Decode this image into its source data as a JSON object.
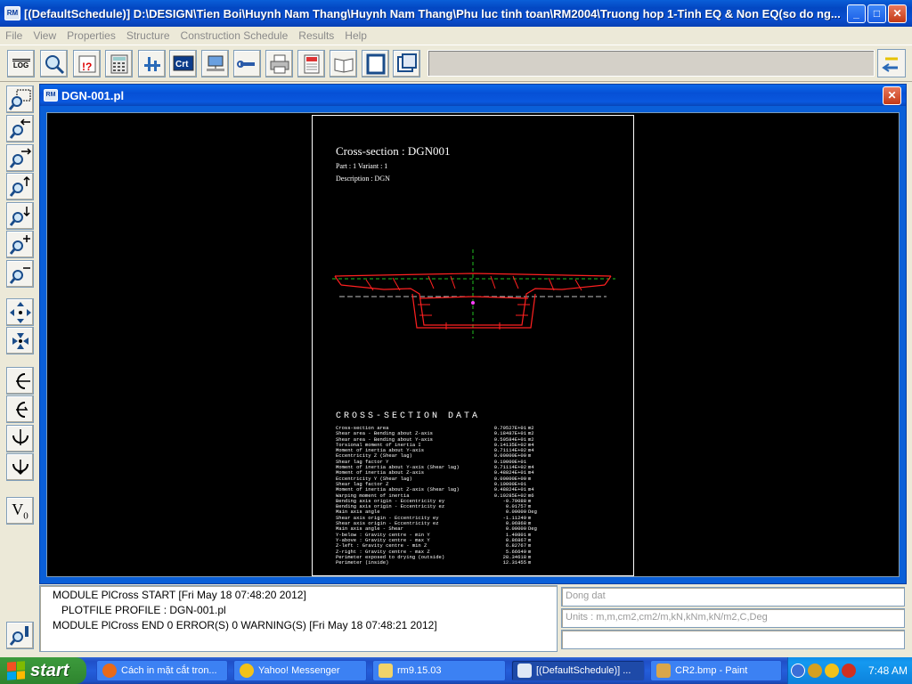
{
  "window": {
    "title": "[(DefaultSchedule)] D:\\DESIGN\\Tien Boi\\Huynh Nam Thang\\Huynh Nam Thang\\Phu luc tinh toan\\RM2004\\Truong hop 1-Tinh EQ & Non EQ(so do ng...",
    "logo": "RM",
    "minimize": "_",
    "maximize": "□",
    "close": "✕"
  },
  "menu": [
    "File",
    "View",
    "Properties",
    "Structure",
    "Construction Schedule",
    "Results",
    "Help"
  ],
  "toolbar": {
    "log_label": "LOG",
    "buttons": [
      "log-icon",
      "zoom-icon",
      "help-query-icon",
      "calculator-icon",
      "structure-icon",
      "crt-icon",
      "network-icon",
      "wrench-icon",
      "printer-icon",
      "report-icon",
      "book-icon",
      "frame-icon",
      "window-icon"
    ],
    "crt_label": "Crt"
  },
  "left_toolbar": {
    "v0_label": "V",
    "v0_sub": "0"
  },
  "child_window": {
    "title": "DGN-001.pl",
    "logo": "RM",
    "close": "✕"
  },
  "plot": {
    "title": "Cross-section : DGN001",
    "part_line": "Part : 1   Variant : 1",
    "description_line": "Description   : DGN",
    "data_heading": "CROSS-SECTION DATA",
    "rows": [
      {
        "label": "Cross-section area",
        "value": "0.70527E+01",
        "unit": "m2"
      },
      {
        "label": "Shear area - Bending about Z-axis",
        "value": "0.18487E+01",
        "unit": "m2"
      },
      {
        "label": "Shear area - Bending about Y-axis",
        "value": "0.50584E+01",
        "unit": "m2"
      },
      {
        "label": "Torsional moment of inertia I",
        "value": "0.14135E+02",
        "unit": "m4"
      },
      {
        "label": "Moment of inertia about Y-axis",
        "value": "0.71114E+02",
        "unit": "m4"
      },
      {
        "label": "Eccentricity Z (Shear lag)",
        "value": "0.00000E+00",
        "unit": "m"
      },
      {
        "label": "Shear lag factor Y",
        "value": "0.10000E+01",
        "unit": ""
      },
      {
        "label": "Moment of inertia about Y-axis (Shear lag)",
        "value": "0.71114E+02",
        "unit": "m4"
      },
      {
        "label": "Moment of inertia about Z-axis",
        "value": "0.48824E+01",
        "unit": "m4"
      },
      {
        "label": "Eccentricity Y (Shear lag)",
        "value": "0.00000E+00",
        "unit": "m"
      },
      {
        "label": "Shear lag factor Z",
        "value": "0.10000E+01",
        "unit": ""
      },
      {
        "label": "Moment of inertia about Z-axis (Shear lag)",
        "value": "0.48824E+01",
        "unit": "m4"
      },
      {
        "label": "Warping moment of inertia",
        "value": "0.10285E+02",
        "unit": "m6"
      },
      {
        "label": "Bending axis origin - Eccentricity ey",
        "value": "-0.79088",
        "unit": "m"
      },
      {
        "label": "Bending axis origin - Eccentricity ez",
        "value": "0.01757",
        "unit": "m"
      },
      {
        "label": "Main axis angle",
        "value": "0.00000",
        "unit": "Deg"
      },
      {
        "label": "Shear axis origin - Eccentricity ey",
        "value": "-1.11249",
        "unit": "m"
      },
      {
        "label": "Shear axis origin - Eccentricity ez",
        "value": "0.06868",
        "unit": "m"
      },
      {
        "label": "Main axis angle - Shear",
        "value": "0.00000",
        "unit": "Deg"
      },
      {
        "label": "Y-below : Gravity centre - min Y",
        "value": "1.49801",
        "unit": "m"
      },
      {
        "label": "Y-above : Gravity centre - max Y",
        "value": "0.86867",
        "unit": "m"
      },
      {
        "label": "Z-left  : Gravity centre - min Z",
        "value": "6.82767",
        "unit": "m"
      },
      {
        "label": "Z-right : Gravity centre - max Z",
        "value": "5.66649",
        "unit": "m"
      },
      {
        "label": "Perimeter exposed to drying (outside)",
        "value": "28.34618",
        "unit": "m"
      },
      {
        "label": "Perimeter (inside)",
        "value": "12.31455",
        "unit": "m"
      }
    ]
  },
  "log": {
    "line1": "MODULE PlCross START [Fri May 18 07:48:20 2012]",
    "line2": "PLOTFILE PROFILE : DGN-001.pl",
    "line3": "MODULE PlCross END      0 ERROR(S)      0 WARNING(S) [Fri May 18 07:48:21 2012]"
  },
  "info": {
    "box1": "Dong dat",
    "box2": "Units : m,m,cm2,cm2/m,kN,kNm,kN/m2,C,Deg",
    "box3": ""
  },
  "taskbar": {
    "start": "start",
    "tasks": [
      {
        "label": "Cách in mặt cắt tron...",
        "color": "#e86a1a"
      },
      {
        "label": "Yahoo! Messenger",
        "color": "#f2c21a"
      },
      {
        "label": "rm9.15.03",
        "color": "#f1d36a"
      },
      {
        "label": "[(DefaultSchedule)] ...",
        "color": "#dfe8f5"
      },
      {
        "label": "CR2.bmp - Paint",
        "color": "#d9a64a"
      }
    ],
    "clock": "7:48 AM"
  },
  "colors": {
    "section_red": "#ff2020",
    "axis_green": "#20c020"
  }
}
